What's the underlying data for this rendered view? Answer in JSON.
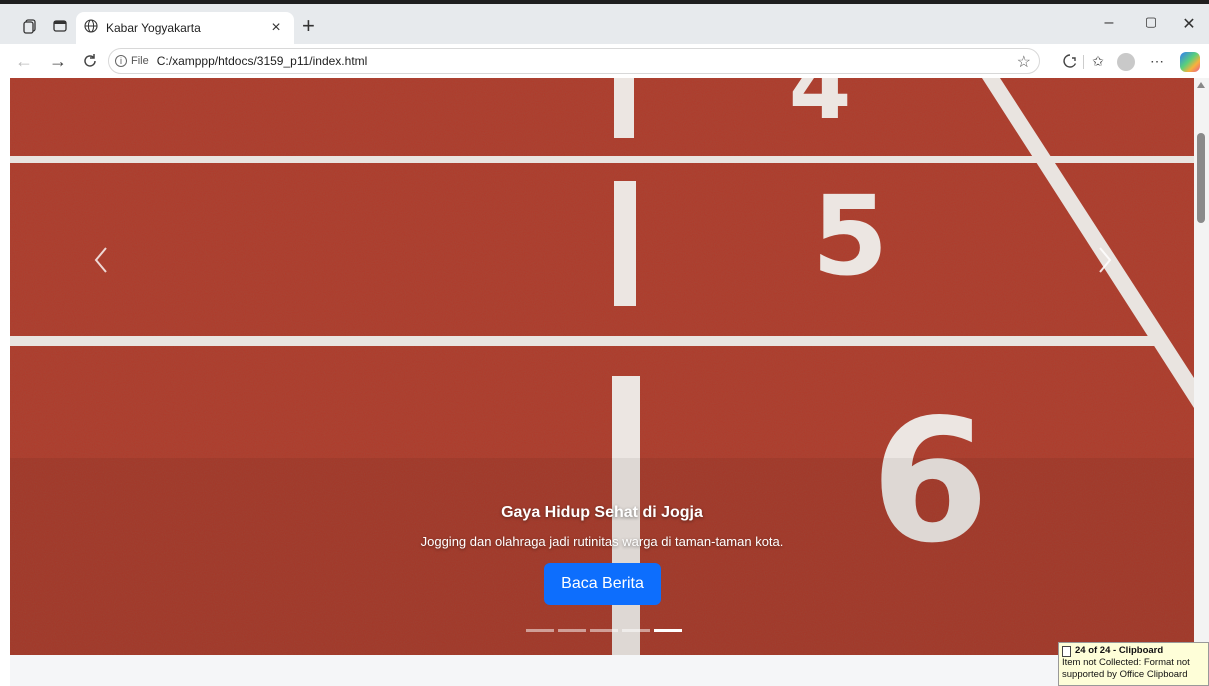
{
  "browser": {
    "tab_title": "Kabar Yogyakarta",
    "tab_close": "×",
    "new_tab": "+",
    "address_chip": "File",
    "url": "C:/xamppp/htdocs/3159_p11/index.html",
    "window_controls": {
      "minimize": "–",
      "maximize": "▢",
      "close": "✕"
    },
    "icons": [
      "workspaces-icon",
      "tab-actions-icon",
      "globe-icon",
      "back-icon",
      "forward-icon",
      "reload-icon",
      "info-icon",
      "favorite-star-icon",
      "extensions-icon",
      "favorites-icon",
      "profile-avatar",
      "more-icon",
      "copilot-icon"
    ]
  },
  "carousel": {
    "title": "Gaya Hidup Sehat di Jogja",
    "text": "Jogging dan olahraga jadi rutinitas warga di taman-taman kota.",
    "button_label": "Baca Berita",
    "indicator_count": 5,
    "active_indicator": 5,
    "track_numbers": [
      "4",
      "5",
      "6"
    ],
    "colors": {
      "track": "#b03a2a",
      "button": "#0d6efd"
    }
  },
  "clipboard_toast": {
    "title": "24 of 24 - Clipboard",
    "message": "Item not Collected: Format not supported by Office Clipboard"
  }
}
